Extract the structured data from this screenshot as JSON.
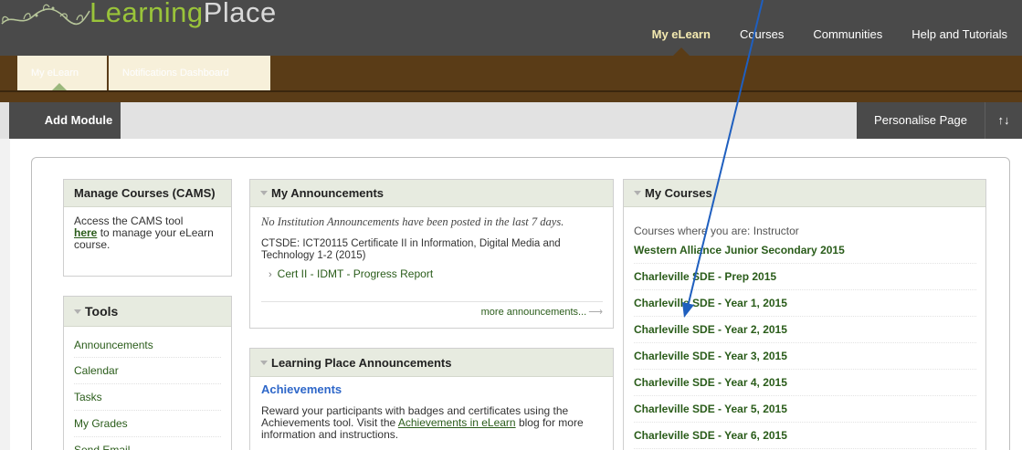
{
  "brand": {
    "logo_learning": "Learning",
    "logo_place": "Place",
    "accent": "#9ac43a"
  },
  "topnav": {
    "items": [
      {
        "label": "My eLearn",
        "active": true
      },
      {
        "label": "Courses",
        "active": false
      },
      {
        "label": "Communities",
        "active": false
      },
      {
        "label": "Help and Tutorials",
        "active": false
      }
    ]
  },
  "subnav": {
    "tabs": [
      {
        "label": "My eLearn",
        "active": true
      },
      {
        "label": "Notifications Dashboard",
        "active": false
      }
    ]
  },
  "actionbar": {
    "add_module": "Add Module",
    "personalise": "Personalise Page",
    "sort_icon": "↑↓"
  },
  "cams": {
    "title": "Manage Courses (CAMS)",
    "text_before": "Access the CAMS tool",
    "link": "here",
    "text_after": " to manage your eLearn course."
  },
  "tools": {
    "title": "Tools",
    "items": [
      "Announcements",
      "Calendar",
      "Tasks",
      "My Grades",
      "Send Email"
    ]
  },
  "announcements": {
    "title": "My Announcements",
    "none_text": "No Institution Announcements have been posted in the last 7 days.",
    "course": "CTSDE: ICT20115 Certificate II in Information, Digital Media and Technology 1-2 (2015)",
    "link": "Cert II - IDMT - Progress Report",
    "more": "more announcements..."
  },
  "lp_announcements": {
    "title": "Learning Place Announcements",
    "item_title": "Achievements",
    "text_before": "Reward your participants with badges and certificates using the Achievements tool. Visit the ",
    "link": "Achievements in eLearn",
    "text_after": " blog for more information and instructions."
  },
  "courses": {
    "title": "My Courses",
    "intro": "Courses where you are: Instructor",
    "items": [
      "Western Alliance Junior Secondary 2015",
      "Charleville SDE - Prep 2015",
      "Charleville SDE - Year 1, 2015",
      "Charleville SDE - Year 2, 2015",
      "Charleville SDE - Year 3, 2015",
      "Charleville SDE - Year 4, 2015",
      "Charleville SDE - Year 5, 2015",
      "Charleville SDE - Year 6, 2015"
    ]
  }
}
